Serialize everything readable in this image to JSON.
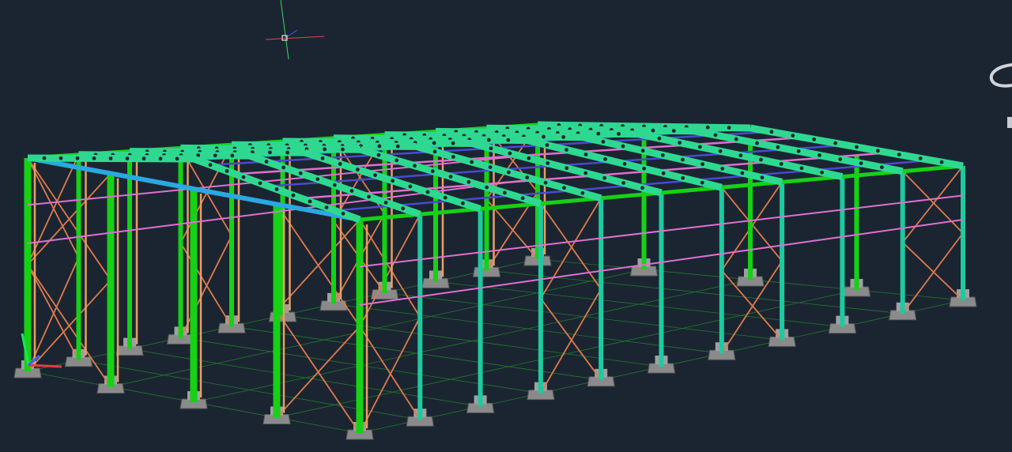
{
  "colors": {
    "background": "#1b2532",
    "grid": "#1f7a2a",
    "column_main": "#16d116",
    "column_teal": "#1fc9a0",
    "column_orange": "#e6a060",
    "bracing": "#e07a4a",
    "truss": "#2fd890",
    "truss_hole": "#1b2532",
    "purlin_blue": "#4a4ad0",
    "purlin_pink": "#e070d0",
    "beam_blue": "#2aa8e0",
    "footing": "#8a8a8a",
    "axis_x": "#e04040",
    "axis_y": "#20e060",
    "axis_z": "#4060ff",
    "crosshair_x": "#e04848",
    "crosshair_y": "#30d860"
  },
  "model": {
    "frames": 11,
    "bays_wide": 4,
    "has_gable_bracing": true,
    "has_wall_bracing": true
  },
  "icons": {
    "cursor": "crosshair-cursor-icon",
    "ucs": "ucs-axis-icon",
    "viewcube": "viewcube-icon"
  }
}
